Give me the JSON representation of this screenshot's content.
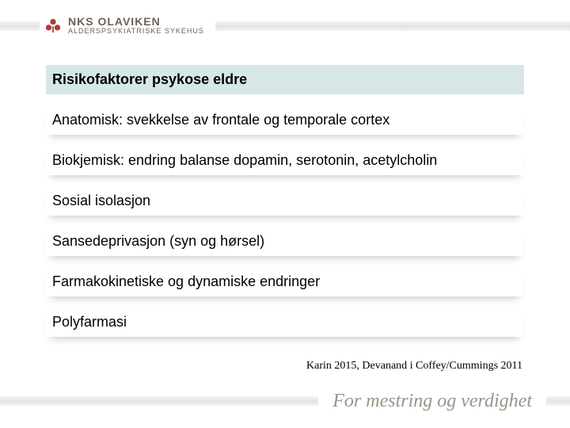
{
  "logo": {
    "brand": "NKS OLAVIKEN",
    "subline": "ALDERSPSYKIATRISKE SYKEHUS"
  },
  "title": "Risikofaktorer psykose eldre",
  "rows": [
    "Anatomisk: svekkelse av frontale og temporale cortex",
    "Biokjemisk: endring balanse dopamin, serotonin, acetylcholin",
    "Sosial isolasjon",
    "Sansedeprivasjon (syn og hørsel)",
    "Farmakokinetiske og dynamiske endringer",
    "Polyfarmasi"
  ],
  "citation": "Karin 2015, Devanand i Coffey/Cummings 2011",
  "tagline": "For mestring og verdighet"
}
